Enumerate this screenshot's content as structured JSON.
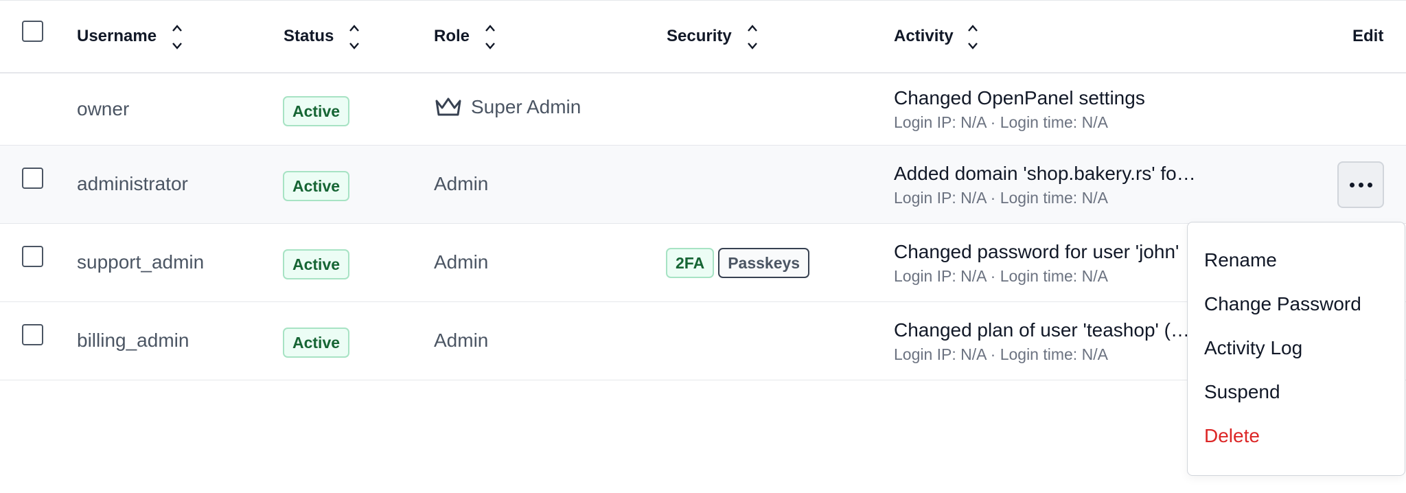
{
  "table": {
    "headers": {
      "username": "Username",
      "status": "Status",
      "role": "Role",
      "security": "Security",
      "activity": "Activity",
      "edit": "Edit"
    },
    "rows": [
      {
        "username": "owner",
        "status": "Active",
        "role": "Super Admin",
        "role_icon": "crown-icon",
        "security": [],
        "activity_title": "Changed OpenPanel settings",
        "activity_meta": "Login IP: N/A · Login time: N/A",
        "has_checkbox": false
      },
      {
        "username": "administrator",
        "status": "Active",
        "role": "Admin",
        "security": [],
        "activity_title": "Added domain 'shop.bakery.rs' fo…",
        "activity_meta": "Login IP: N/A · Login time: N/A",
        "has_checkbox": true,
        "highlighted": true
      },
      {
        "username": "support_admin",
        "status": "Active",
        "role": "Admin",
        "security": [
          "2FA",
          "Passkeys"
        ],
        "activity_title": "Changed password for user 'john'",
        "activity_meta": "Login IP: N/A · Login time: N/A",
        "has_checkbox": true
      },
      {
        "username": "billing_admin",
        "status": "Active",
        "role": "Admin",
        "security": [],
        "activity_title": "Changed plan of user 'teashop' (v…",
        "activity_meta": "Login IP: N/A · Login time: N/A",
        "has_checkbox": true
      }
    ]
  },
  "actions_menu": {
    "trigger_icon": "more-horizontal-icon",
    "items": [
      "Rename",
      "Change Password",
      "Activity Log",
      "Suspend",
      "Delete"
    ]
  },
  "colors": {
    "active_badge_text": "#166534",
    "active_badge_bg": "#ecfdf5",
    "danger": "#dc2626",
    "highlight_row_bg": "#f8f9fb"
  }
}
